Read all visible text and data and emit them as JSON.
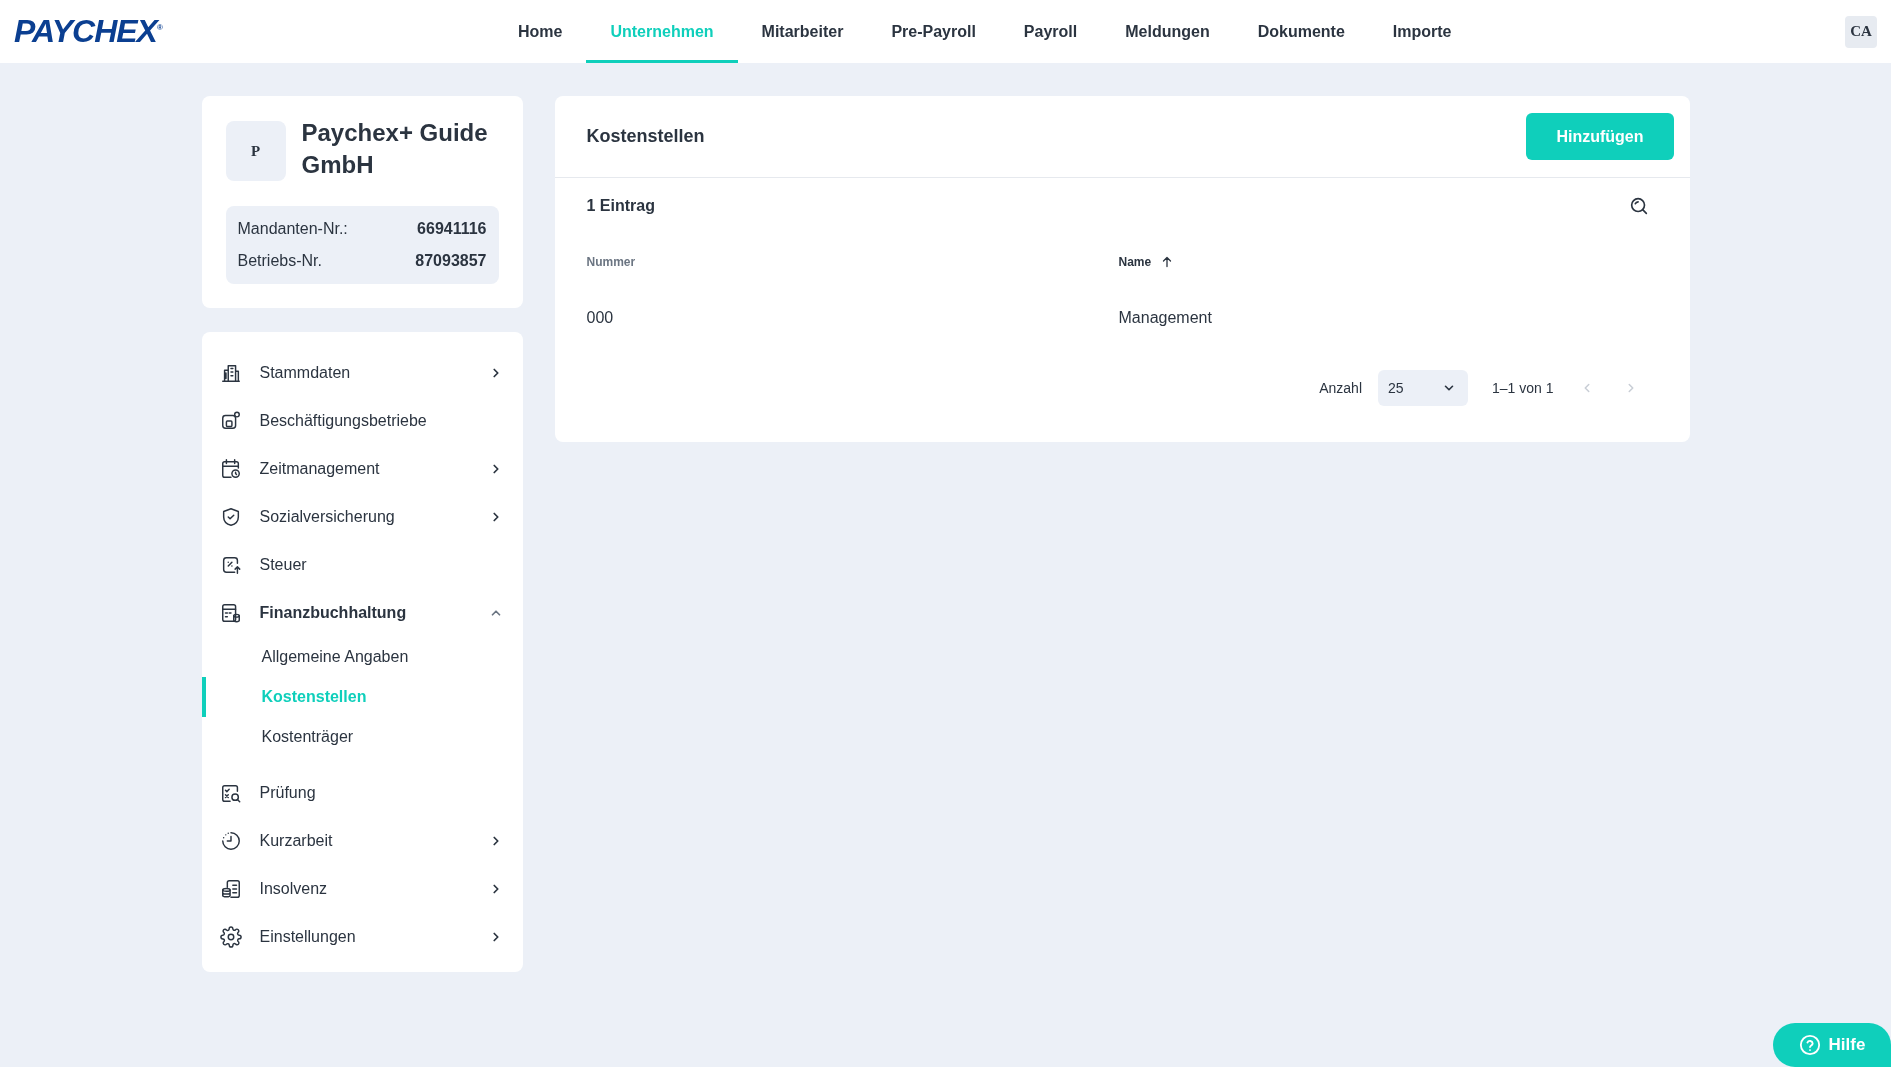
{
  "header": {
    "logo": "PAYCHEX",
    "logo_mark": "®",
    "nav": [
      {
        "label": "Home",
        "selected": false
      },
      {
        "label": "Unternehmen",
        "selected": true
      },
      {
        "label": "Mitarbeiter",
        "selected": false
      },
      {
        "label": "Pre-Payroll",
        "selected": false
      },
      {
        "label": "Payroll",
        "selected": false
      },
      {
        "label": "Meldungen",
        "selected": false
      },
      {
        "label": "Dokumente",
        "selected": false
      },
      {
        "label": "Importe",
        "selected": false
      }
    ],
    "user_initials": "CA"
  },
  "company": {
    "avatar": "P",
    "name": "Paychex+ Guide GmbH",
    "info": [
      {
        "label": "Mandanten-Nr.:",
        "value": "66941116"
      },
      {
        "label": "Betriebs-Nr.",
        "value": "87093857"
      }
    ]
  },
  "sidebar": {
    "items": [
      {
        "label": "Stammdaten",
        "expanded": false
      },
      {
        "label": "Beschäftigungsbetriebe"
      },
      {
        "label": "Zeitmanagement",
        "expanded": false
      },
      {
        "label": "Sozialversicherung",
        "expanded": false
      },
      {
        "label": "Steuer"
      },
      {
        "label": "Finanzbuchhaltung",
        "expanded": true,
        "children": [
          {
            "label": "Allgemeine Angaben",
            "selected": false
          },
          {
            "label": "Kostenstellen",
            "selected": true
          },
          {
            "label": "Kostenträger",
            "selected": false
          }
        ]
      },
      {
        "label": "Prüfung"
      },
      {
        "label": "Kurzarbeit",
        "expanded": false
      },
      {
        "label": "Insolvenz",
        "expanded": false
      },
      {
        "label": "Einstellungen",
        "expanded": false
      }
    ]
  },
  "main": {
    "title": "Kostenstellen",
    "add_button": "Hinzufügen",
    "count": "1 Eintrag",
    "table": {
      "columns": [
        {
          "label": "Nummer",
          "sorted": false
        },
        {
          "label": "Name",
          "sorted": true
        }
      ],
      "rows": [
        [
          "000",
          "Management"
        ]
      ]
    },
    "pagination": {
      "page_size_label": "Anzahl",
      "page_size": "25",
      "range": "1–1 von 1",
      "prev_disabled": true,
      "next_disabled": true
    }
  },
  "help_button": "Hilfe"
}
